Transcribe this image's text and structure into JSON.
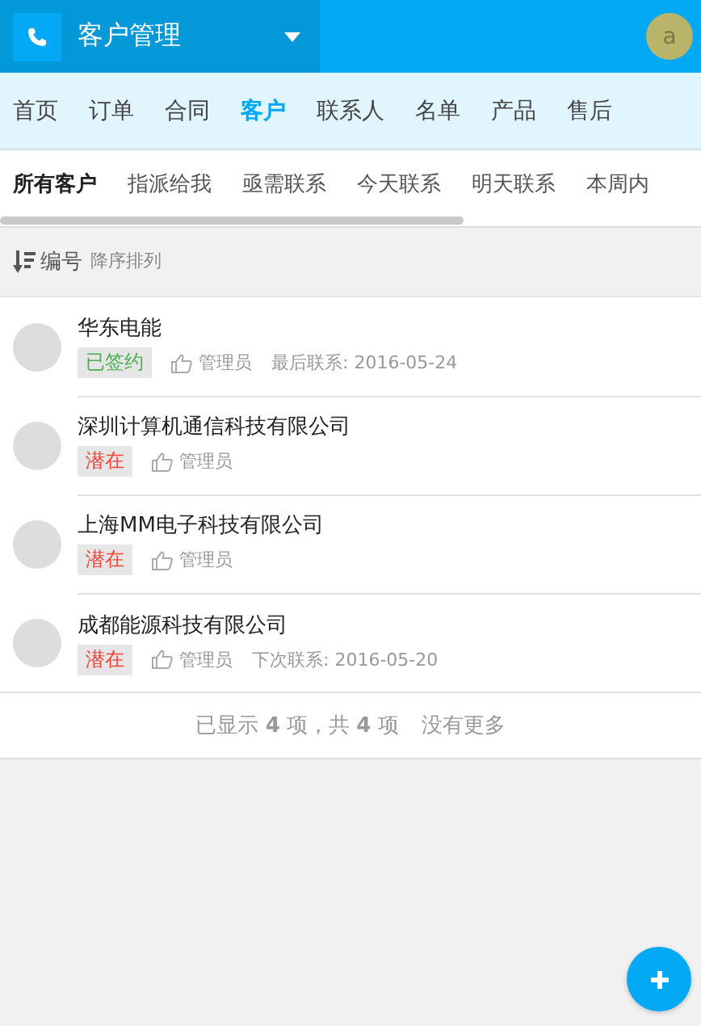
{
  "header": {
    "title": "客户管理",
    "avatar": "a"
  },
  "nav": [
    {
      "label": "首页",
      "selected": false
    },
    {
      "label": "订单",
      "selected": false
    },
    {
      "label": "合同",
      "selected": false
    },
    {
      "label": "客户",
      "selected": true
    },
    {
      "label": "联系人",
      "selected": false
    },
    {
      "label": "名单",
      "selected": false
    },
    {
      "label": "产品",
      "selected": false
    },
    {
      "label": "售后",
      "selected": false
    }
  ],
  "filters": [
    {
      "label": "所有客户",
      "selected": true
    },
    {
      "label": "指派给我",
      "selected": false
    },
    {
      "label": "亟需联系",
      "selected": false
    },
    {
      "label": "今天联系",
      "selected": false
    },
    {
      "label": "明天联系",
      "selected": false
    },
    {
      "label": "本周内",
      "selected": false
    }
  ],
  "sort": {
    "field": "编号",
    "order": "降序排列"
  },
  "customers": [
    {
      "name": "华东电能",
      "status": "已签约",
      "color": "#4caf50",
      "owner": "管理员",
      "contact": "最后联系: 2016-05-24"
    },
    {
      "name": "深圳计算机通信科技有限公司",
      "status": "潜在",
      "color": "#f44336",
      "owner": "管理员"
    },
    {
      "name": "上海MM电子科技有限公司",
      "status": "潜在",
      "color": "#f44336",
      "owner": "管理员"
    },
    {
      "name": "成都能源科技有限公司",
      "status": "潜在",
      "color": "#f44336",
      "owner": "管理员",
      "contact": "下次联系: 2016-05-20"
    }
  ],
  "footer": {
    "summary": "已显示 **4** 项，共 **4** 项",
    "more": "没有更多"
  }
}
